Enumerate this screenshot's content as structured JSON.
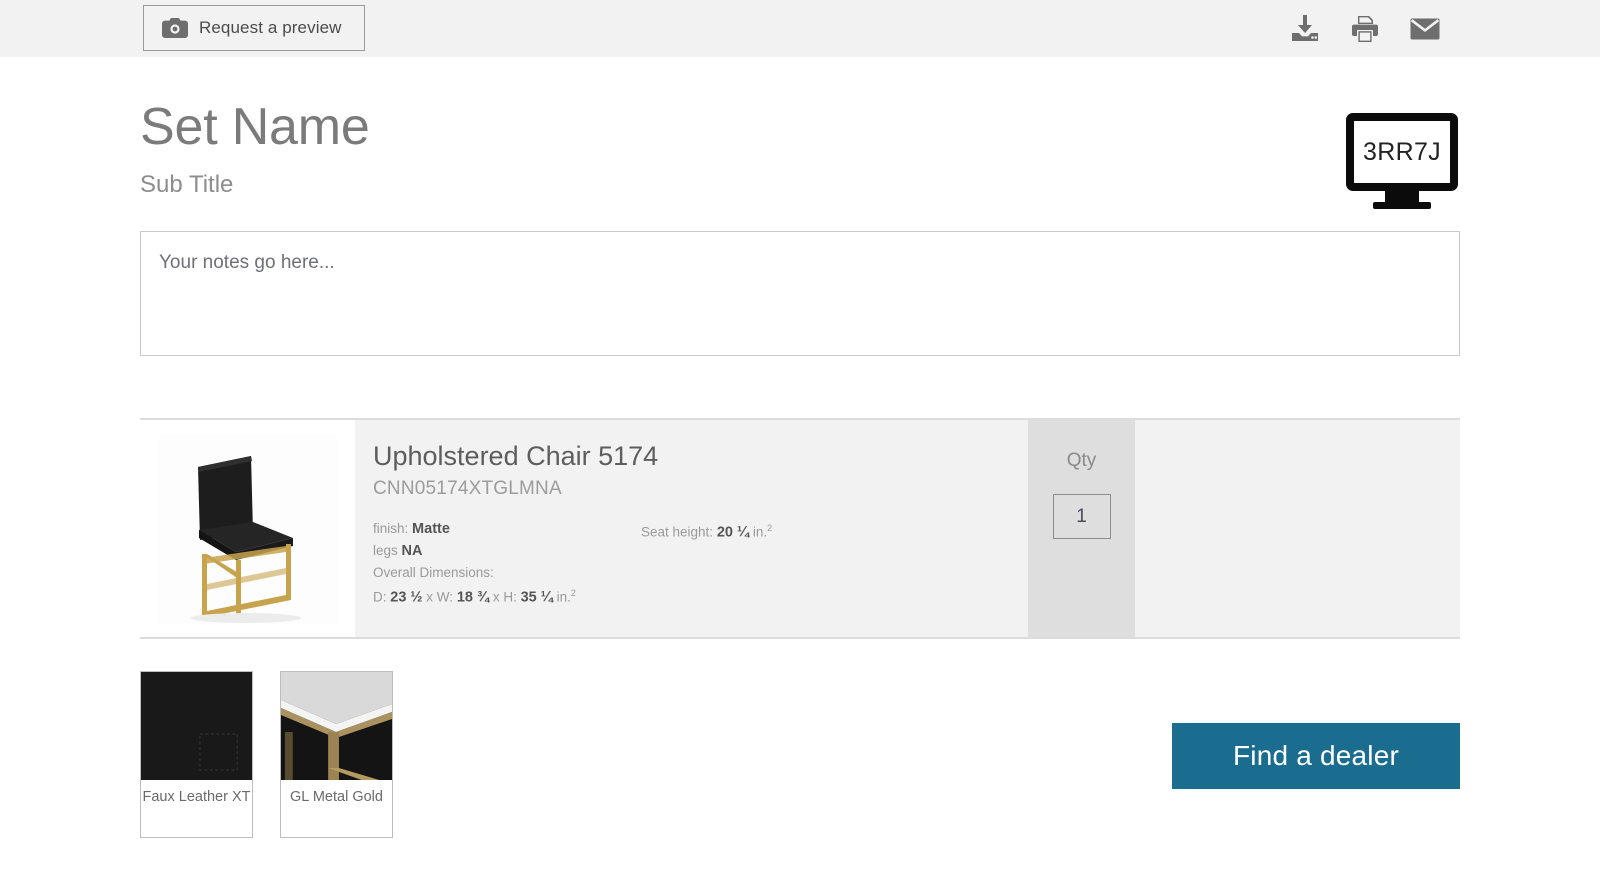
{
  "toolbar": {
    "preview_button_label": "Request a preview",
    "preview_icon": "camera-icon",
    "icons": [
      {
        "name": "download-icon",
        "title": "Download"
      },
      {
        "name": "print-icon",
        "title": "Print"
      },
      {
        "name": "email-icon",
        "title": "Email"
      }
    ]
  },
  "header": {
    "title": "Set Name",
    "subtitle": "Sub Title",
    "code_badge": {
      "icon": "monitor-icon",
      "code": "3RR7J"
    }
  },
  "notes": {
    "placeholder": "Your notes go here...",
    "value": ""
  },
  "product": {
    "image_alt": "black upholstered chair with gold metal base",
    "title": "Upholstered Chair 5174",
    "sku": "CNN05174XTGLMNA",
    "specs_left": [
      {
        "label": "finish:",
        "value": "Matte"
      },
      {
        "label": "legs",
        "value": "NA"
      }
    ],
    "dimensions_heading": "Overall Dimensions:",
    "dimensions": {
      "d_label": "D:",
      "d_value": "23 ½",
      "sep1": "x",
      "w_label": "W:",
      "w_value": "18 ¾",
      "sep2": "x",
      "h_label": "H:",
      "h_value": "35 ¼",
      "unit": "in.",
      "unit_sup": "2"
    },
    "seat_height": {
      "label": "Seat height:",
      "value": "20 ¼",
      "unit": "in.",
      "unit_sup": "2"
    },
    "qty": {
      "label": "Qty",
      "value": "1"
    }
  },
  "swatches": [
    {
      "name": "Faux Leather XT",
      "type": "fabric-black"
    },
    {
      "name": "GL Metal Gold",
      "type": "metal-gold"
    }
  ],
  "actions": {
    "find_dealer_label": "Find a dealer"
  },
  "colors": {
    "toolbar_bg": "#f2f2f2",
    "accent": "#1b6d90",
    "row_bg": "#f2f2f2",
    "qty_bg": "#dedede",
    "text_muted": "#9a9a9a"
  }
}
